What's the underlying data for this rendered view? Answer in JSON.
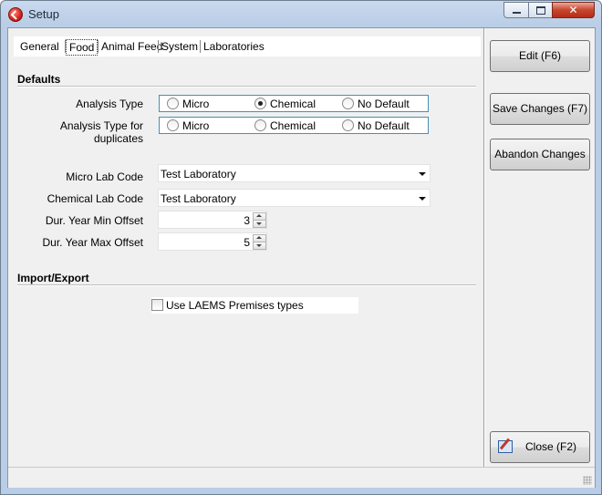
{
  "window": {
    "title": "Setup",
    "controls": {
      "minimize": "",
      "maximize": "",
      "close": "✕"
    }
  },
  "tabs": [
    "General",
    "Food",
    "Animal Feed",
    "System",
    "Laboratories"
  ],
  "active_tab": "Food",
  "defaults": {
    "section_title": "Defaults",
    "analysis_type": {
      "label": "Analysis Type",
      "options": [
        "Micro",
        "Chemical",
        "No Default"
      ],
      "selected": "Chemical"
    },
    "analysis_type_duplicates": {
      "label": "Analysis Type for duplicates",
      "options": [
        "Micro",
        "Chemical",
        "No Default"
      ],
      "selected": ""
    },
    "micro_lab_code": {
      "label": "Micro Lab Code",
      "value": "Test Laboratory"
    },
    "chemical_lab_code": {
      "label": "Chemical Lab Code",
      "value": "Test Laboratory"
    },
    "dur_year_min_offset": {
      "label": "Dur. Year Min Offset",
      "value": "3"
    },
    "dur_year_max_offset": {
      "label": "Dur. Year Max Offset",
      "value": "5"
    }
  },
  "import_export": {
    "section_title": "Import/Export",
    "use_laems_premises": {
      "label": "Use LAEMS Premises types",
      "checked": false
    }
  },
  "buttons": {
    "edit": "Edit (F6)",
    "save": "Save Changes (F7)",
    "abandon": "Abandon Changes",
    "close": "Close (F2)"
  }
}
